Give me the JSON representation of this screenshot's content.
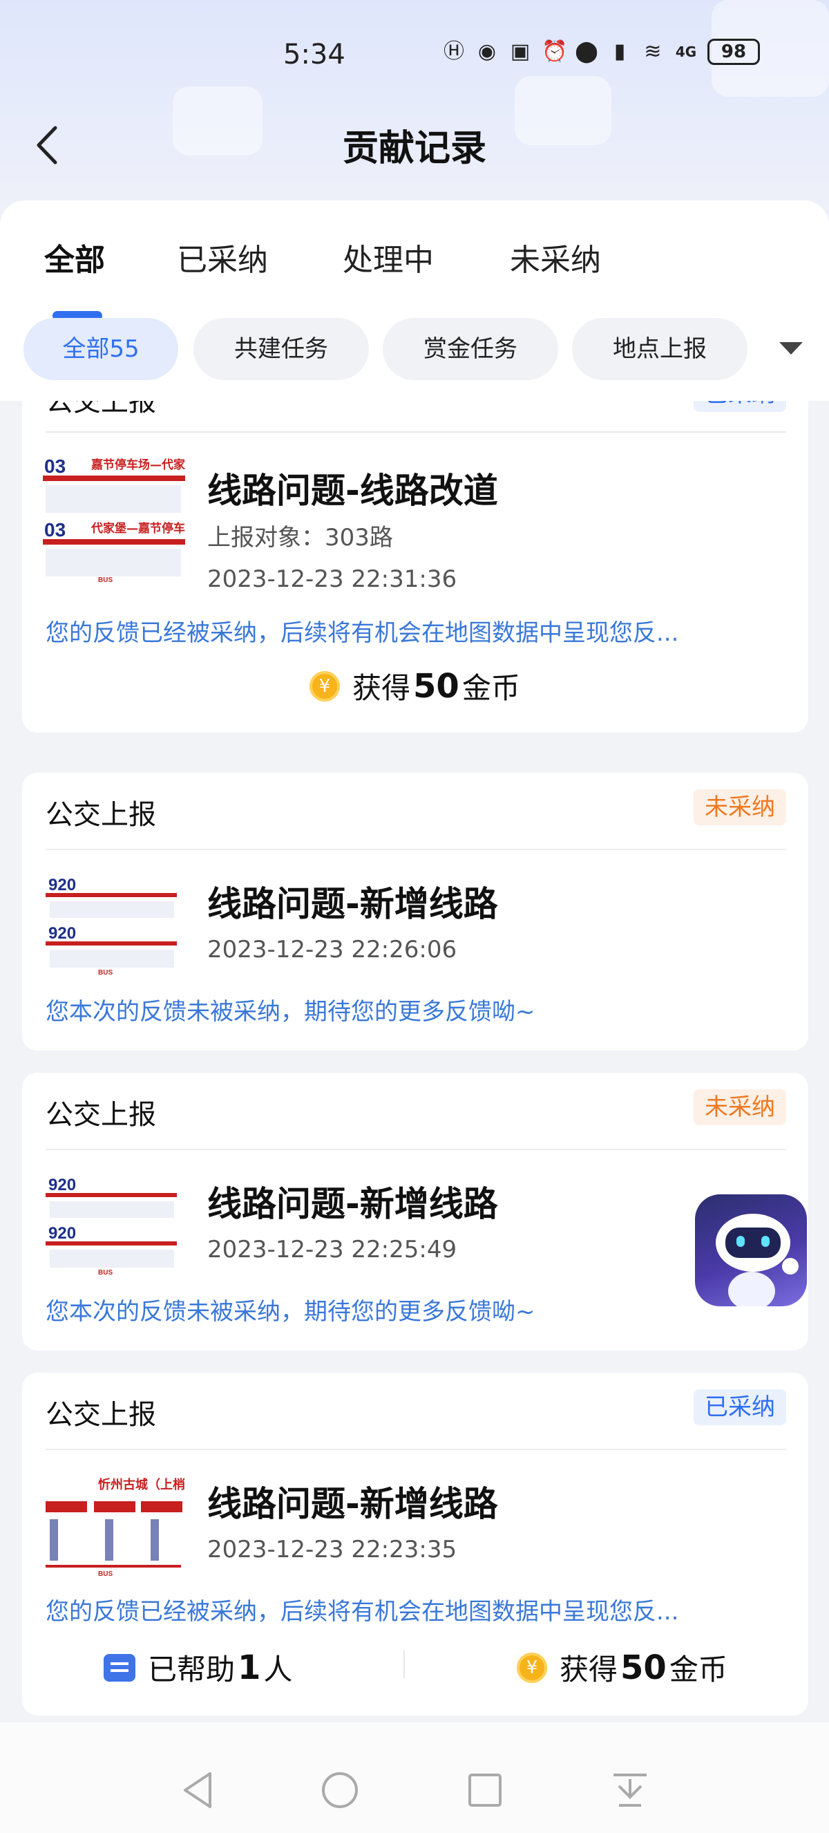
{
  "status_bar": {
    "time": "5:34",
    "battery": "98",
    "network": "4G"
  },
  "header": {
    "title": "贡献记录"
  },
  "tabs": [
    {
      "label": "全部",
      "active": true
    },
    {
      "label": "已采纳",
      "active": false
    },
    {
      "label": "处理中",
      "active": false
    },
    {
      "label": "未采纳",
      "active": false
    }
  ],
  "filters": [
    {
      "label": "全部55",
      "active": true
    },
    {
      "label": "共建任务",
      "active": false
    },
    {
      "label": "赏金任务",
      "active": false
    },
    {
      "label": "地点上报",
      "active": false
    }
  ],
  "cards": [
    {
      "type": "公交上报",
      "status": "已采纳",
      "thumb_title": "03",
      "thumb_text": "嘉节停车场—代家",
      "thumb_text2": "代家堡—嘉节停车",
      "issue": "线路问题-线路改道",
      "target_label": "上报对象：303路",
      "time": "2023-12-23 22:31:36",
      "note": "您的反馈已经被采纳，后续将有机会在地图数据中呈现您反...",
      "reward_prefix": "获得",
      "reward_amount": "50",
      "reward_unit": "金币"
    },
    {
      "type": "公交上报",
      "status": "未采纳",
      "thumb_title": "920",
      "issue": "线路问题-新增线路",
      "time": "2023-12-23 22:26:06",
      "note": "您本次的反馈未被采纳，期待您的更多反馈呦~"
    },
    {
      "type": "公交上报",
      "status": "未采纳",
      "thumb_title": "920",
      "issue": "线路问题-新增线路",
      "time": "2023-12-23 22:25:49",
      "note": "您本次的反馈未被采纳，期待您的更多反馈呦~"
    },
    {
      "type": "公交上报",
      "status": "已采纳",
      "thumb_title": "忻州古城（上梢",
      "issue": "线路问题-新增线路",
      "time": "2023-12-23 22:23:35",
      "note": "您的反馈已经被采纳，后续将有机会在地图数据中呈现您反...",
      "helped_prefix": "已帮助",
      "helped_count": "1",
      "helped_unit": "人",
      "reward_prefix": "获得",
      "reward_amount": "50",
      "reward_unit": "金币"
    }
  ],
  "colors": {
    "accent": "#2f6ff0",
    "rejected": "#ee7a23",
    "note": "#3a78d8",
    "coin": "#f7b31a"
  },
  "icons": [
    "back-icon",
    "chevron-down-icon",
    "coin-icon",
    "help-icon",
    "assistant-robot-icon",
    "nav-back-icon",
    "nav-home-icon",
    "nav-recents-icon",
    "nav-notification-icon"
  ]
}
